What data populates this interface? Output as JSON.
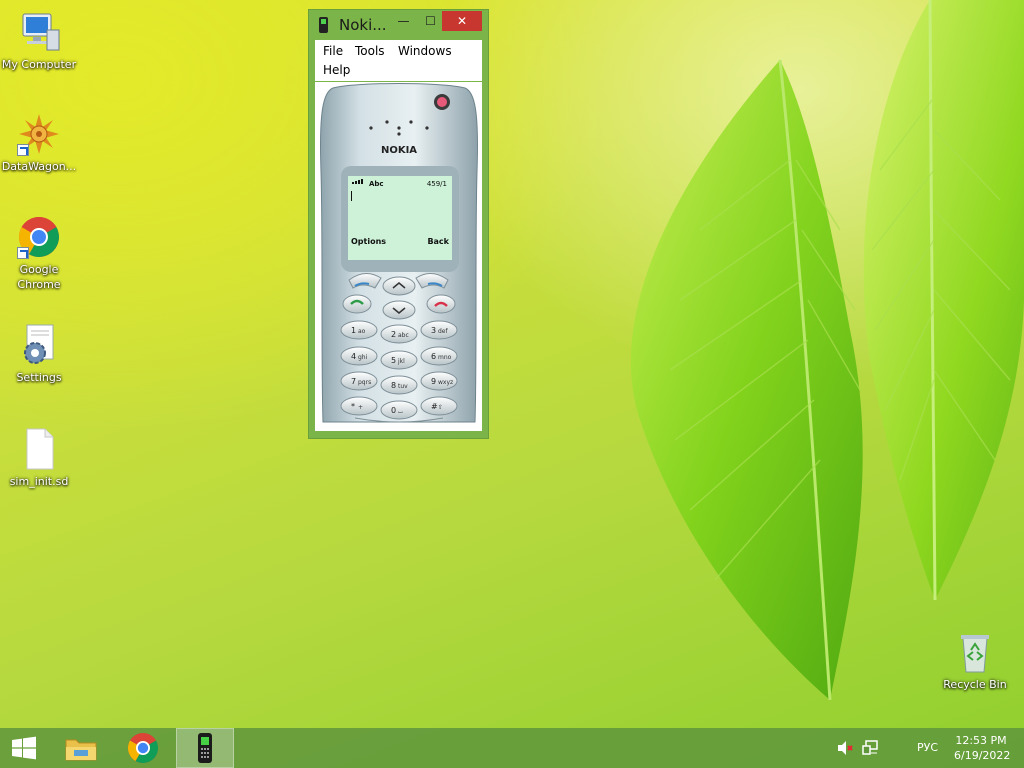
{
  "desktop": {
    "icons": [
      {
        "label": "My Computer",
        "icon": "computer-icon"
      },
      {
        "label": "DataWagon...",
        "icon": "datawagon-icon"
      },
      {
        "label": "Google Chrome",
        "icon": "chrome-icon"
      },
      {
        "label": "Settings",
        "icon": "settings-icon"
      },
      {
        "label": "sim_init.sd",
        "icon": "file-icon"
      },
      {
        "label": "Recycle Bin",
        "icon": "recycle-bin-icon"
      }
    ]
  },
  "window": {
    "title": "Noki...",
    "controls": {
      "minimize": "—",
      "maximize": "☐",
      "close": "✕"
    },
    "menu": [
      "File",
      "Tools",
      "Windows",
      "Help"
    ]
  },
  "phone": {
    "brand": "NOKIA",
    "screen": {
      "mode": "Abc",
      "counter": "459/1",
      "left_soft": "Options",
      "right_soft": "Back"
    },
    "keys": [
      {
        "num": "1",
        "letters": "ao"
      },
      {
        "num": "2",
        "letters": "abc"
      },
      {
        "num": "3",
        "letters": "def"
      },
      {
        "num": "4",
        "letters": "ghi"
      },
      {
        "num": "5",
        "letters": "jkl"
      },
      {
        "num": "6",
        "letters": "mno"
      },
      {
        "num": "7",
        "letters": "pqrs"
      },
      {
        "num": "8",
        "letters": "tuv"
      },
      {
        "num": "9",
        "letters": "wxyz"
      },
      {
        "num": "*",
        "letters": "+"
      },
      {
        "num": "0",
        "letters": "⌴"
      },
      {
        "num": "#",
        "letters": "⇧"
      }
    ]
  },
  "taskbar": {
    "items": [
      "start-icon",
      "file-explorer-icon",
      "chrome-icon",
      "nokia-phone-icon"
    ],
    "language": "РУС",
    "time": "12:53 PM",
    "date": "6/19/2022"
  },
  "colors": {
    "window_frame": "#7bb449",
    "close_button": "#c7372f",
    "lcd": "#cdf2d8",
    "taskbar": "#60963c"
  }
}
